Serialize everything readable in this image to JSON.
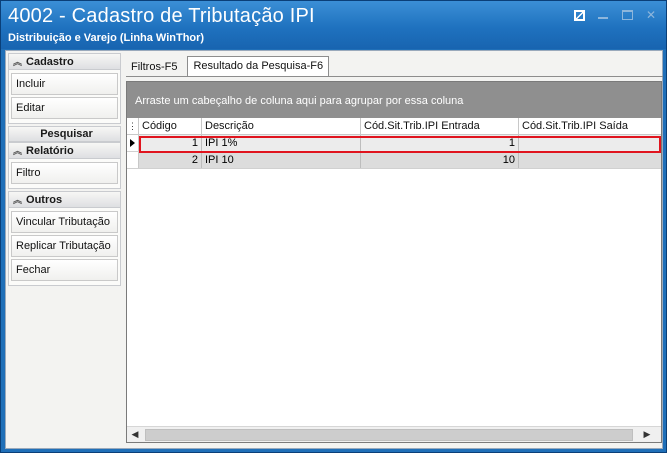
{
  "window": {
    "title": "4002 - Cadastro de Tributação IPI",
    "subtitle": "Distribuição e Varejo (Linha WinThor)"
  },
  "sidebar": {
    "cadastro": {
      "header": "Cadastro",
      "items": [
        "Incluir",
        "Editar"
      ]
    },
    "pesquisar": {
      "header": "Pesquisar"
    },
    "relatorio": {
      "header": "Relatório",
      "items": [
        "Filtro"
      ]
    },
    "outros": {
      "header": "Outros",
      "items": [
        "Vincular Tributação",
        "Replicar Tributação",
        "Fechar"
      ]
    }
  },
  "tabs": [
    "Filtros-F5",
    "Resultado da Pesquisa-F6"
  ],
  "grid": {
    "group_hint": "Arraste um cabeçalho de coluna aqui para agrupar por essa coluna",
    "columns": [
      "Código",
      "Descrição",
      "Cód.Sit.Trib.IPI Entrada",
      "Cód.Sit.Trib.IPI Saída"
    ],
    "rows": [
      {
        "codigo": "1",
        "descricao": "IPI 1%",
        "entrada": "1",
        "saida": ""
      },
      {
        "codigo": "2",
        "descricao": "IPI 10",
        "entrada": "10",
        "saida": ""
      }
    ]
  }
}
